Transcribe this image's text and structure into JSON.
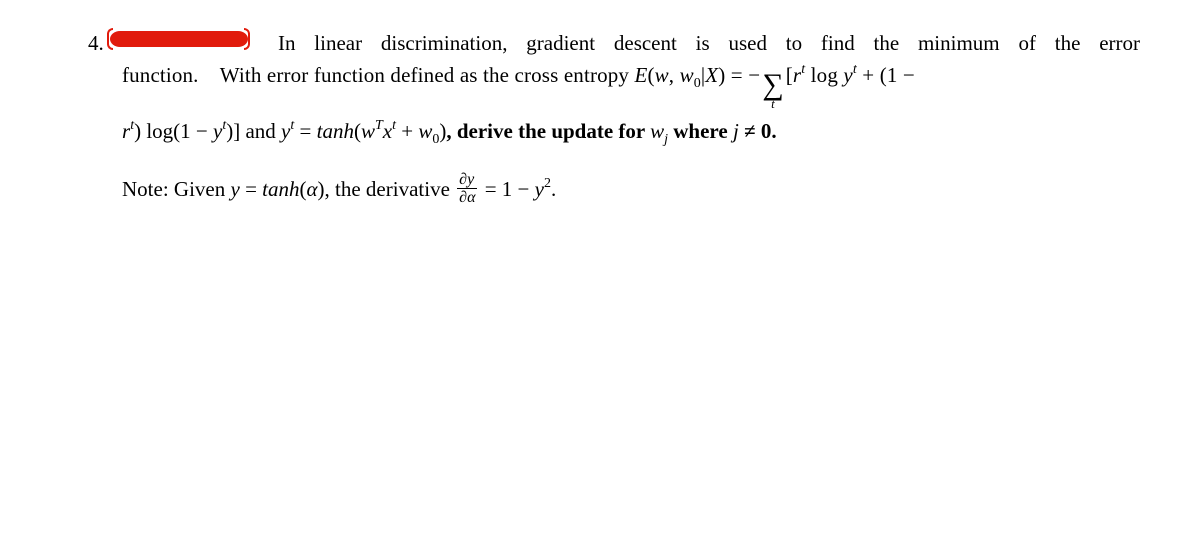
{
  "problem": {
    "number": "4.",
    "line1_start": "In linear discrimination, gradient descent is used to find the minimum of the error",
    "line2_pre": "function. With error function defined as the cross entropy ",
    "E_text": "E",
    "E_args_open": "(",
    "w": "w",
    "comma": ", ",
    "w0": "w",
    "zero": "0",
    "bar": "|",
    "X": "X",
    "E_args_close": ")",
    "eq": " = ",
    "minus": "−",
    "sigma_sub": "t",
    "lbrack": "[",
    "r": "r",
    "t_sup": "t",
    "log": " log ",
    "y": "y",
    "plus_open": " + (1 −",
    "line3_pre": "",
    "rparen_log": ") log(1 − ",
    "rbrack_closeparen": ")]",
    "and_word": " and ",
    "eq2": " = ",
    "tanh": "tanh",
    "wTx_open": "(",
    "T": "T",
    "x": "x",
    "plus": " + ",
    "wTx_close": ")",
    "derive_text": ", derive the update for ",
    "w_j": "w",
    "j_sub": "j",
    "where_text": " where ",
    "j": "j",
    "neq": " ≠ 0.",
    "note_pre": "Note: Given ",
    "y_eq_tanh_a": " = ",
    "alpha": "α",
    "note_mid": ", the derivative ",
    "partial": "∂",
    "one_minus_y2": " = 1 − ",
    "sq": "2",
    "dot": "."
  }
}
